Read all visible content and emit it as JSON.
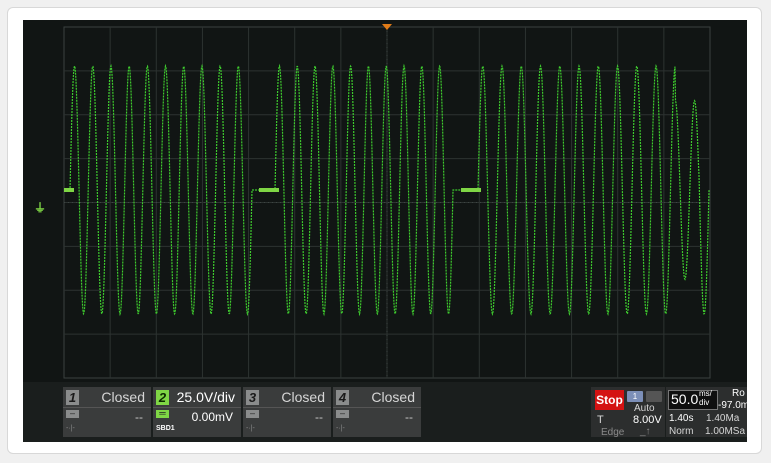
{
  "colors": {
    "trace": "#3ecb2e",
    "grid": "#2d3331",
    "screen": "#111514",
    "ch2": "#7fd645",
    "stop": "#d41212"
  },
  "waveform": {
    "marker": "2",
    "bursts": 3,
    "cycles_per_burst": 10
  },
  "channels": [
    {
      "number": "1",
      "status": "Closed",
      "value": "--"
    },
    {
      "number": "2",
      "status": "25.0V/div",
      "value": "0.00mV",
      "tag": "SBD1"
    },
    {
      "number": "3",
      "status": "Closed",
      "value": "--"
    },
    {
      "number": "4",
      "status": "Closed",
      "value": "--"
    }
  ],
  "trigger": {
    "run_state": "Stop",
    "mode": "Auto",
    "source": "T",
    "level": "8.00V",
    "type": "Edge"
  },
  "timebase": {
    "value": "50.0",
    "unit_top": "ms/",
    "unit_bottom": "div",
    "position": "1.40s",
    "points": "1.40Ma",
    "mode": "Norm",
    "sample_rate": "1.00MSa",
    "roll": "Ro",
    "offset": "-97.0m"
  }
}
